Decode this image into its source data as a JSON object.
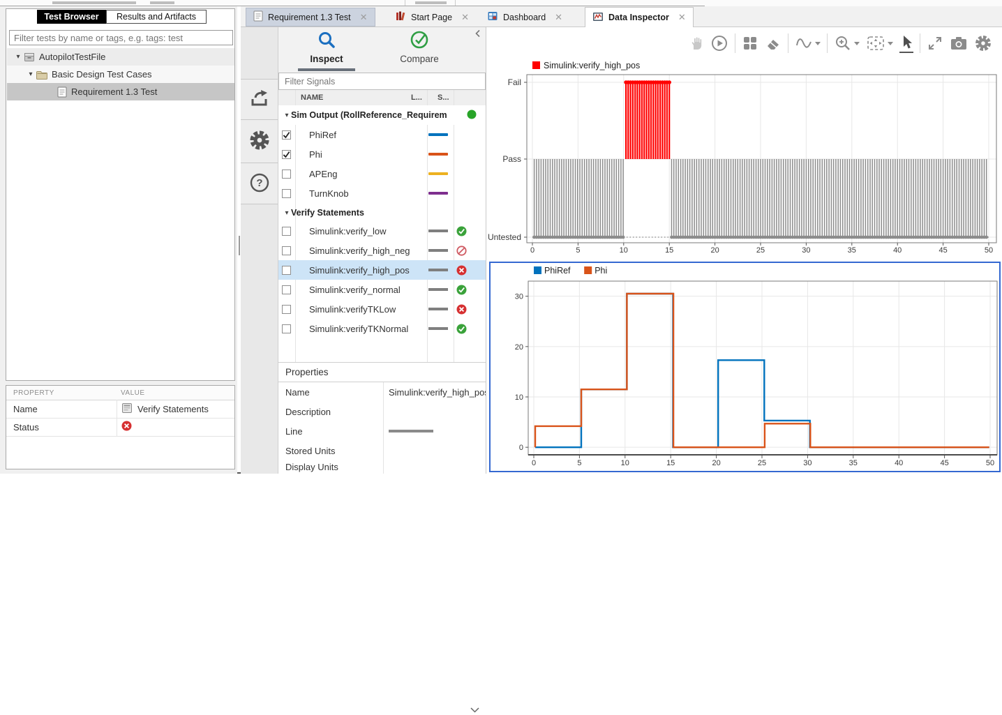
{
  "main_tabs": [
    {
      "label": "Requirement 1.3 Test",
      "icon": "document-icon",
      "state": "highlighted"
    },
    {
      "label": "Start Page",
      "icon": "start-page-icon",
      "state": "normal"
    },
    {
      "label": "Dashboard",
      "icon": "dashboard-icon",
      "state": "normal"
    },
    {
      "label": "Data Inspector",
      "icon": "data-inspector-icon",
      "state": "active"
    }
  ],
  "left_panel": {
    "tabs": [
      {
        "label": "Test Browser",
        "active": true
      },
      {
        "label": "Results and Artifacts",
        "active": false
      }
    ],
    "filter_placeholder": "Filter tests by name or tags, e.g. tags: test",
    "tree": [
      {
        "label": "AutopilotTestFile",
        "icon": "test-file-icon",
        "expanded": true,
        "selected": false
      },
      {
        "label": "Basic Design Test Cases",
        "icon": "folder-icon",
        "expanded": true,
        "selected": false
      },
      {
        "label": "Requirement 1.3 Test",
        "icon": "test-case-icon",
        "expanded": false,
        "selected": true
      }
    ],
    "property_table": {
      "col_property": "PROPERTY",
      "col_value": "VALUE",
      "name_label": "Name",
      "name_value": "Verify Statements",
      "name_value_icon": "verify-statements-icon",
      "status_label": "Status",
      "status_value": "fail"
    }
  },
  "inspector": {
    "side_toolbar_icons": [
      "export-icon",
      "preferences-gear-icon",
      "help-icon"
    ],
    "inspect_tab": "Inspect",
    "compare_tab": "Compare",
    "collapse_icon": "collapse-left-icon",
    "filter_placeholder": "Filter Signals",
    "columns": {
      "name": "NAME",
      "line": "L...",
      "status": "S..."
    },
    "sim_output_group": "Sim Output (RollReference_Requirem",
    "sim_output_status_color": "#28A428",
    "signals": [
      {
        "name": "PhiRef",
        "checked": true,
        "color": "#0072BD"
      },
      {
        "name": "Phi",
        "checked": true,
        "color": "#D95319"
      },
      {
        "name": "APEng",
        "checked": false,
        "color": "#EDB120"
      },
      {
        "name": "TurnKnob",
        "checked": false,
        "color": "#7E2F8E"
      }
    ],
    "verify_group": "Verify Statements",
    "verify_signals": [
      {
        "name": "Simulink:verify_low",
        "checked": false,
        "line_color": "#7F7F7F",
        "status": "pass",
        "selected": false
      },
      {
        "name": "Simulink:verify_high_neg",
        "checked": false,
        "line_color": "#7F7F7F",
        "status": "untested",
        "selected": false
      },
      {
        "name": "Simulink:verify_high_pos",
        "checked": false,
        "line_color": "#7F7F7F",
        "status": "fail",
        "selected": true
      },
      {
        "name": "Simulink:verify_normal",
        "checked": false,
        "line_color": "#7F7F7F",
        "status": "pass",
        "selected": false
      },
      {
        "name": "Simulink:verifyTKLow",
        "checked": false,
        "line_color": "#7F7F7F",
        "status": "fail",
        "selected": false
      },
      {
        "name": "Simulink:verifyTKNormal",
        "checked": false,
        "line_color": "#7F7F7F",
        "status": "pass",
        "selected": false
      }
    ],
    "properties": {
      "title": "Properties",
      "rows": [
        {
          "label": "Name",
          "value": "Simulink:verify_high_pos"
        },
        {
          "label": "Description",
          "value": ""
        },
        {
          "label": "Line",
          "value": "",
          "line_swatch_color": "#8A8A8A"
        },
        {
          "label": "Stored Units",
          "value": ""
        },
        {
          "label": "Display Units",
          "value": ""
        }
      ]
    }
  },
  "chart_toolbar_icons": [
    "pan-hand-icon",
    "replay-icon",
    "layout-grid-icon",
    "eraser-icon",
    "signal-wave-icon",
    "zoom-in-icon",
    "fit-to-view-icon",
    "cursor-arrow-icon",
    "expand-icon",
    "snapshot-camera-icon",
    "settings-gear-icon"
  ],
  "colors": {
    "selection_row": "#CDE4F7",
    "selected_subplot_border": "#3468D1",
    "status_pass": "#3AA23A",
    "status_fail": "#D63031",
    "status_untested": "#CF5B63",
    "verify_fail_series": "#FF0000",
    "verify_untested_series": "#8C8C8C"
  },
  "chart_data": [
    {
      "type": "verify_stem",
      "title": "Simulink:verify_high_pos",
      "legend": [
        {
          "label": "Simulink:verify_high_pos",
          "color": "#FF0000"
        }
      ],
      "xlim": [
        0,
        50
      ],
      "x_ticks": [
        0,
        5,
        10,
        15,
        20,
        25,
        30,
        35,
        40,
        45,
        50
      ],
      "y_levels": [
        "Untested",
        "Pass",
        "Fail"
      ],
      "sample_step": 0.25,
      "segments": [
        {
          "t_start": 0.2,
          "t_end": 10,
          "base": "Untested",
          "value": "Pass",
          "color": "#8C8C8C",
          "marker_at": "Untested"
        },
        {
          "t_start": 10.25,
          "t_end": 15,
          "base": "Pass",
          "value": "Fail",
          "color": "#FF0000",
          "marker_at": "Fail"
        },
        {
          "t_start": 15.25,
          "t_end": 49.95,
          "base": "Untested",
          "value": "Pass",
          "color": "#8C8C8C",
          "marker_at": "Untested"
        }
      ],
      "grid": true
    },
    {
      "type": "step",
      "legend": [
        {
          "label": "PhiRef",
          "color": "#0072BD"
        },
        {
          "label": "Phi",
          "color": "#D95319"
        }
      ],
      "xlim": [
        0,
        50
      ],
      "ylim": [
        -1.5,
        33
      ],
      "x_ticks": [
        0,
        5,
        10,
        15,
        20,
        25,
        30,
        35,
        40,
        45,
        50
      ],
      "y_ticks": [
        0,
        10,
        20,
        30
      ],
      "series": [
        {
          "name": "PhiRef",
          "color": "#0072BD",
          "points": [
            [
              0.15,
              0
            ],
            [
              5.2,
              0
            ],
            [
              5.2,
              11.5
            ],
            [
              10.2,
              11.5
            ],
            [
              10.2,
              30.5
            ],
            [
              15.25,
              30.5
            ],
            [
              15.25,
              0
            ],
            [
              20.2,
              0
            ],
            [
              20.2,
              17.3
            ],
            [
              25.25,
              17.3
            ],
            [
              25.25,
              5.3
            ],
            [
              30.25,
              5.3
            ],
            [
              30.25,
              0
            ],
            [
              49.9,
              0
            ]
          ]
        },
        {
          "name": "Phi",
          "color": "#D95319",
          "points": [
            [
              0.15,
              0
            ],
            [
              0.15,
              4.2
            ],
            [
              5.2,
              4.2
            ],
            [
              5.2,
              11.5
            ],
            [
              10.2,
              11.5
            ],
            [
              10.2,
              30.5
            ],
            [
              15.3,
              30.5
            ],
            [
              15.3,
              0
            ],
            [
              25.3,
              0
            ],
            [
              25.3,
              4.7
            ],
            [
              30.3,
              4.7
            ],
            [
              30.3,
              0
            ],
            [
              49.9,
              0
            ]
          ]
        }
      ],
      "grid": true
    }
  ]
}
